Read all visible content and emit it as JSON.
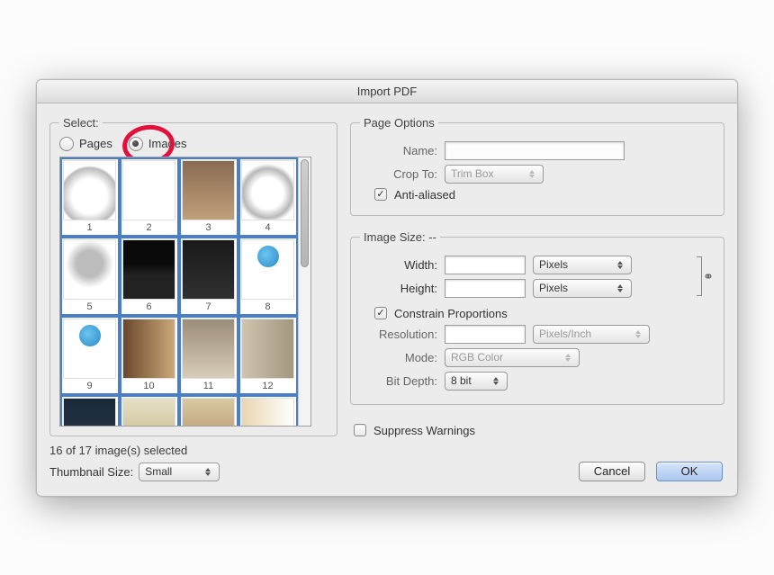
{
  "title": "Import PDF",
  "select": {
    "legend": "Select:",
    "pages_label": "Pages",
    "images_label": "Images",
    "selected_option": "Images"
  },
  "thumbnails": {
    "items": [
      {
        "num": "1"
      },
      {
        "num": "2"
      },
      {
        "num": "3"
      },
      {
        "num": "4"
      },
      {
        "num": "5"
      },
      {
        "num": "6"
      },
      {
        "num": "7"
      },
      {
        "num": "8"
      },
      {
        "num": "9"
      },
      {
        "num": "10"
      },
      {
        "num": "11"
      },
      {
        "num": "12"
      },
      {
        "num": ""
      },
      {
        "num": ""
      },
      {
        "num": ""
      },
      {
        "num": ""
      }
    ],
    "status": "16 of 17 image(s) selected",
    "size_label": "Thumbnail Size:",
    "size_value": "Small"
  },
  "page_options": {
    "legend": "Page Options",
    "name_label": "Name:",
    "name_value": "",
    "crop_label": "Crop To:",
    "crop_value": "Trim Box",
    "antialiased_label": "Anti-aliased",
    "antialiased_checked": true
  },
  "image_size": {
    "legend": "Image Size: --",
    "width_label": "Width:",
    "width_value": "",
    "width_unit": "Pixels",
    "height_label": "Height:",
    "height_value": "",
    "height_unit": "Pixels",
    "constrain_label": "Constrain Proportions",
    "constrain_checked": true,
    "resolution_label": "Resolution:",
    "resolution_value": "",
    "resolution_unit": "Pixels/Inch",
    "mode_label": "Mode:",
    "mode_value": "RGB Color",
    "bitdepth_label": "Bit Depth:",
    "bitdepth_value": "8 bit"
  },
  "suppress_warnings": {
    "label": "Suppress Warnings",
    "checked": false
  },
  "buttons": {
    "cancel": "Cancel",
    "ok": "OK"
  }
}
